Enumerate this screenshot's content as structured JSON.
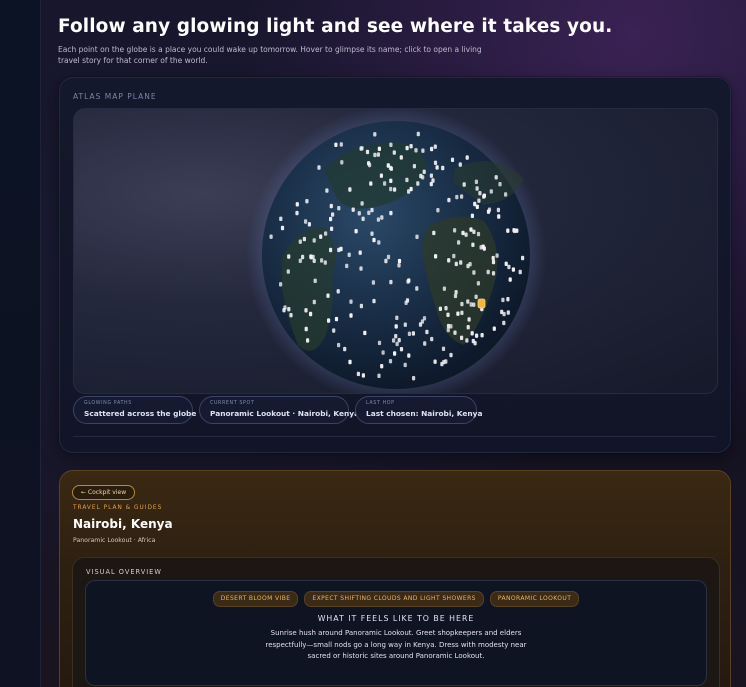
{
  "hero": {
    "title": "Follow any glowing light and see where it takes you.",
    "subtitle": "Each point on the globe is a place you could wake up tomorrow. Hover to glimpse its name; click to open a living travel story for that corner of the world."
  },
  "atlas": {
    "label": "ATLAS MAP PLANE",
    "chips": [
      {
        "key": "GLOWING PATHS",
        "value": "Scattered across the globe"
      },
      {
        "key": "CURRENT SPOT",
        "value": "Panoramic Lookout · Nairobi, Kenya"
      },
      {
        "key": "LAST HOP",
        "value": "Last chosen: Nairobi, Kenya"
      }
    ]
  },
  "plan": {
    "back_label": "← Cockpit view",
    "eyebrow": "TRAVEL PLAN & GUIDES",
    "title": "Nairobi, Kenya",
    "subtitle": "Panoramic Lookout · Africa",
    "visual": {
      "label": "VISUAL OVERVIEW",
      "tags": [
        "DESERT BLOOM VIBE",
        "EXPECT SHIFTING CLOUDS AND LIGHT SHOWERS",
        "PANORAMIC LOOKOUT"
      ],
      "heading": "WHAT IT FEELS LIKE TO BE HERE",
      "body": "Sunrise hush around Panoramic Lookout. Greet shopkeepers and elders respectfully—small nods go a long way in Kenya. Dress with modesty near sacred or historic sites around Panoramic Lookout."
    }
  },
  "colors": {
    "accent_gold": "#e0a34a",
    "selected_marker": "#f2b544",
    "marker": "#f4f4f8"
  }
}
